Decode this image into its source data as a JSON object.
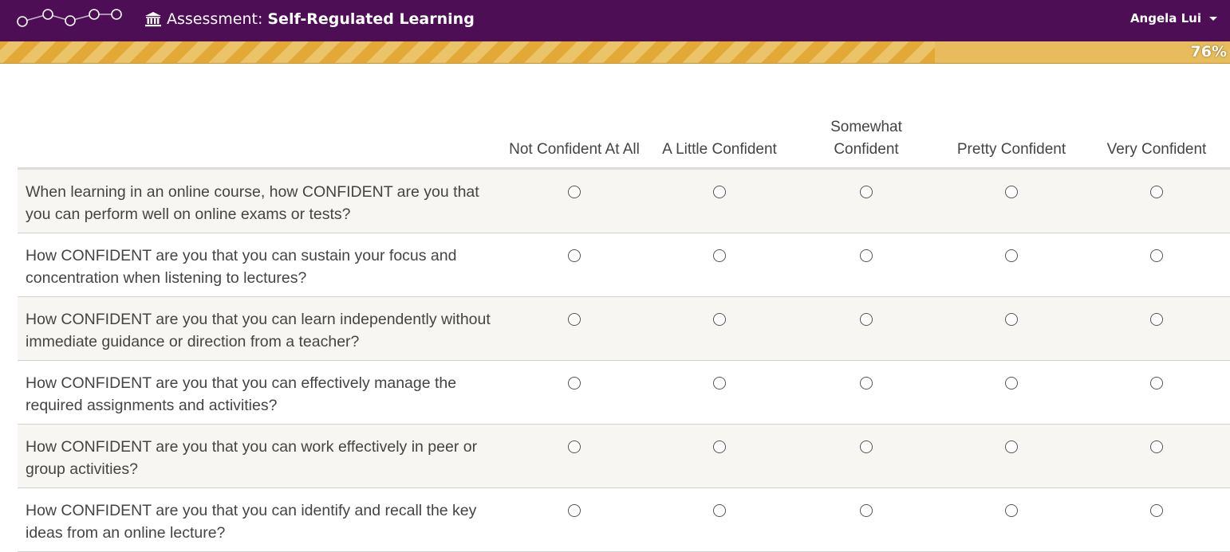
{
  "header": {
    "logo_icon": "connected-circles-logo-icon",
    "assessment_icon": "institution-bank-icon",
    "title_prefix": "Assessment:",
    "title": "Self-Regulated Learning",
    "user_name": "Angela Lui",
    "user_menu_icon": "caret-down-icon",
    "background_color": "#4e0e55"
  },
  "progress": {
    "percent": 76,
    "label": "76%",
    "color": "#e2a936"
  },
  "survey": {
    "columns": [
      "Not Confident At All",
      "A Little Confident",
      "Somewhat Confident",
      "Pretty Confident",
      "Very Confident"
    ],
    "questions": [
      "When learning in an online course, how CONFIDENT are you that you can perform well on online exams or tests?",
      "How CONFIDENT are you that you can sustain your focus and concentration when listening to lectures?",
      "How CONFIDENT are you that you can learn independently without immediate guidance or direction from a teacher?",
      "How CONFIDENT are you that you can effectively manage the required assignments and activities?",
      "How CONFIDENT are you that you can work effectively in peer or group activities?",
      "How CONFIDENT are you that you can identify and recall the key ideas from an online lecture?"
    ],
    "selected": [
      null,
      null,
      null,
      null,
      null,
      null
    ]
  }
}
